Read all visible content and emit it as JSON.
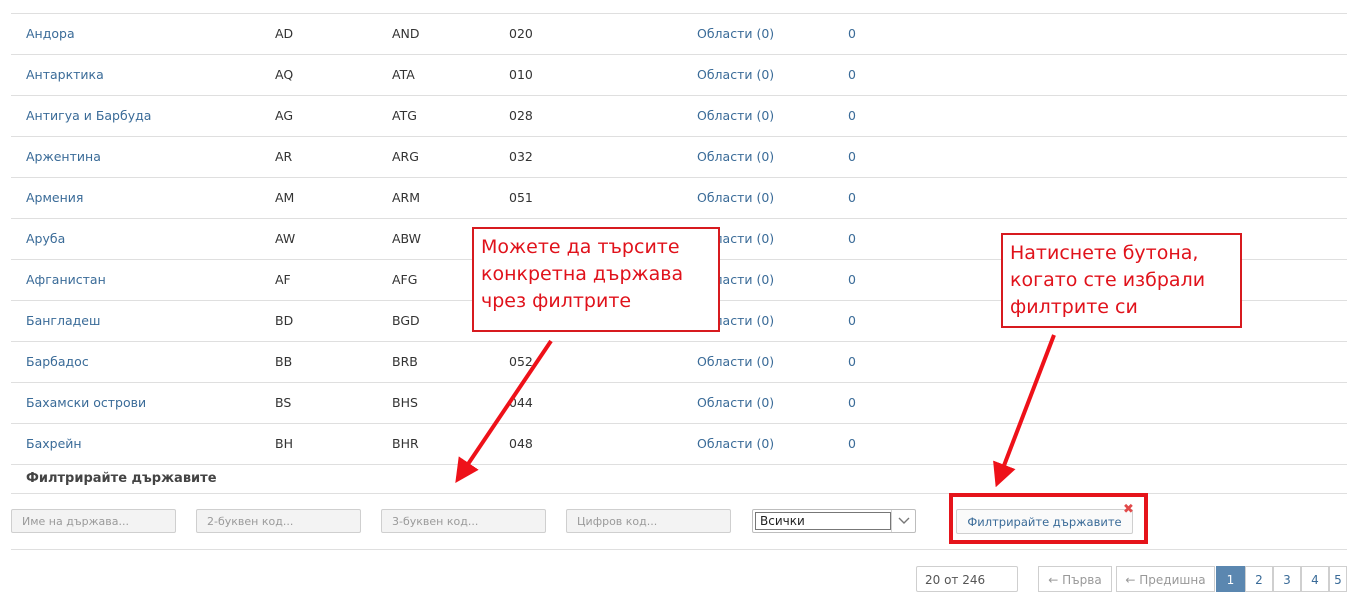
{
  "countries": [
    {
      "name": "Андора",
      "alpha2": "AD",
      "alpha3": "AND",
      "numeric": "020",
      "regions": "Области (0)",
      "count": "0"
    },
    {
      "name": "Антарктика",
      "alpha2": "AQ",
      "alpha3": "ATA",
      "numeric": "010",
      "regions": "Области (0)",
      "count": "0"
    },
    {
      "name": "Антигуа и Барбуда",
      "alpha2": "AG",
      "alpha3": "ATG",
      "numeric": "028",
      "regions": "Области (0)",
      "count": "0"
    },
    {
      "name": "Аржентина",
      "alpha2": "AR",
      "alpha3": "ARG",
      "numeric": "032",
      "regions": "Области (0)",
      "count": "0"
    },
    {
      "name": "Армения",
      "alpha2": "AM",
      "alpha3": "ARM",
      "numeric": "051",
      "regions": "Области (0)",
      "count": "0"
    },
    {
      "name": "Аруба",
      "alpha2": "AW",
      "alpha3": "ABW",
      "numeric": "",
      "regions": "Области (0)",
      "count": "0"
    },
    {
      "name": "Афганистан",
      "alpha2": "AF",
      "alpha3": "AFG",
      "numeric": "",
      "regions": "Области (0)",
      "count": "0"
    },
    {
      "name": "Бангладеш",
      "alpha2": "BD",
      "alpha3": "BGD",
      "numeric": "",
      "regions": "Области (0)",
      "count": "0"
    },
    {
      "name": "Барбадос",
      "alpha2": "BB",
      "alpha3": "BRB",
      "numeric": "052",
      "regions": "Области (0)",
      "count": "0"
    },
    {
      "name": "Бахамски острови",
      "alpha2": "BS",
      "alpha3": "BHS",
      "numeric": "044",
      "regions": "Области (0)",
      "count": "0"
    },
    {
      "name": "Бахрейн",
      "alpha2": "BH",
      "alpha3": "BHR",
      "numeric": "048",
      "regions": "Области (0)",
      "count": "0"
    }
  ],
  "filter": {
    "title": "Филтрирайте държавите",
    "name_placeholder": "Име на държава...",
    "alpha2_placeholder": "2-буквен код...",
    "alpha3_placeholder": "3-буквен код...",
    "numeric_placeholder": "Цифров код...",
    "select_value": "Всички",
    "button_label": "Филтрирайте държавите"
  },
  "callouts": {
    "filters_hint": "Можете да търсите\nконкретна държава\nчрез филтрите",
    "button_hint": "Натиснете бутона,\nкогато сте избрали\nфилтрите си"
  },
  "pagination": {
    "page_size": "20 от 246",
    "first": "← Първа",
    "prev": "← Предишна",
    "pages": [
      "1",
      "2",
      "3",
      "4",
      "5"
    ]
  },
  "colors": {
    "link": "#3a6b98",
    "annotation_red": "#e0121b",
    "active_page": "#5b87b0"
  }
}
